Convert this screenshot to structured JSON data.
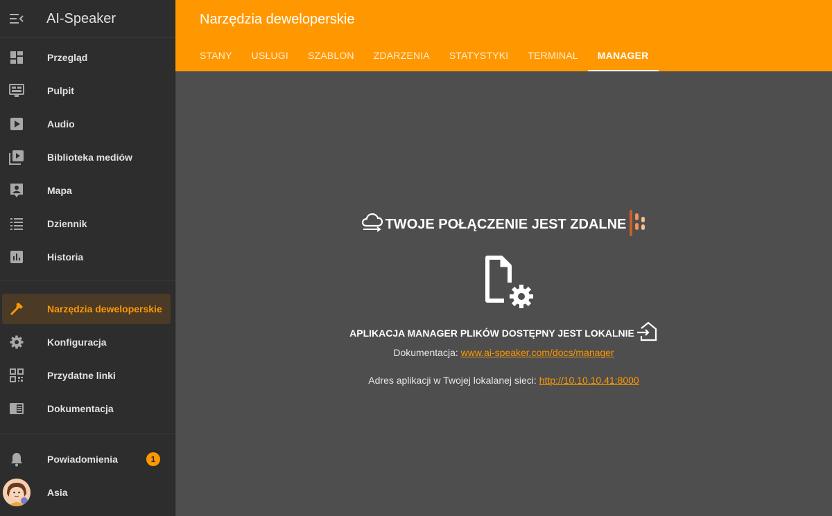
{
  "app": {
    "title": "AI-Speaker"
  },
  "sidebar": {
    "items": [
      {
        "label": "Przegląd",
        "icon": "dashboard-icon"
      },
      {
        "label": "Pulpit",
        "icon": "monitor-icon"
      },
      {
        "label": "Audio",
        "icon": "play-icon"
      },
      {
        "label": "Biblioteka mediów",
        "icon": "media-library-icon"
      },
      {
        "label": "Mapa",
        "icon": "map-person-icon"
      },
      {
        "label": "Dziennik",
        "icon": "list-icon"
      },
      {
        "label": "Historia",
        "icon": "chart-icon"
      },
      {
        "label": "Narzędzia deweloperskie",
        "icon": "hammer-icon"
      },
      {
        "label": "Konfiguracja",
        "icon": "gear-icon"
      },
      {
        "label": "Przydatne linki",
        "icon": "qr-code-icon"
      },
      {
        "label": "Dokumentacja",
        "icon": "book-icon"
      }
    ],
    "notifications": {
      "label": "Powiadomienia",
      "count": "1"
    },
    "user": {
      "name": "Asia"
    }
  },
  "header": {
    "title": "Narzędzia deweloperskie",
    "tabs": [
      "STANY",
      "USŁUGI",
      "SZABLON",
      "ZDARZENIA",
      "STATYSTYKI",
      "TERMINAL",
      "MANAGER"
    ],
    "active_tab": "MANAGER"
  },
  "main": {
    "remote_text": "TWOJE POŁĄCZENIE JEST ZDALNE",
    "local_text": "APLIKACJA MANAGER PLIKÓW DOSTĘPNY JEST LOKALNIE",
    "doc_label": "Dokumentacja:",
    "doc_link": "www.ai-speaker.com/docs/manager",
    "addr_label": "Adres aplikacji w Twojej lokalanej sieci:",
    "addr_link": "http://10.10.10.41:8000"
  },
  "colors": {
    "accent": "#ff9800",
    "sidebar_bg": "#2d2d2d",
    "main_bg": "#4e4e4e"
  }
}
